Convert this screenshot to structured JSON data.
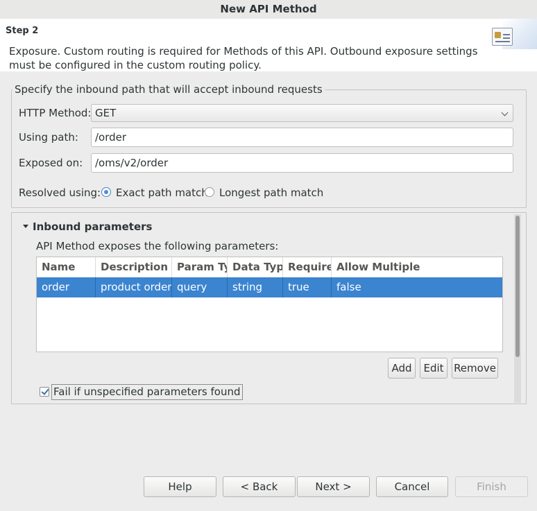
{
  "window": {
    "title": "New API Method"
  },
  "header": {
    "step": "Step 2",
    "description": "Exposure. Custom routing is required for Methods of this API. Outbound exposure settings must be configured in the custom routing policy."
  },
  "inbound_path": {
    "group_title": "Specify the inbound path that will accept inbound requests",
    "http_method_label": "HTTP Method:",
    "http_method_value": "GET",
    "using_path_label": "Using path:",
    "using_path_value": "/order",
    "exposed_on_label": "Exposed on:",
    "exposed_on_value": "/oms/v2/order",
    "resolved_label": "Resolved using:",
    "option_exact": "Exact path match",
    "option_longest": "Longest path match",
    "selected_option": "Exact path match"
  },
  "parameters": {
    "section_title": "Inbound parameters",
    "intro": "API Method exposes the following parameters:",
    "columns": [
      "Name",
      "Description",
      "Param Ty",
      "Data Typ",
      "Require",
      "Allow Multiple"
    ],
    "rows": [
      [
        "order",
        "product order",
        "query",
        "string",
        "true",
        "false"
      ]
    ],
    "add_label": "Add",
    "edit_label": "Edit",
    "remove_label": "Remove",
    "fail_checkbox_label": "Fail if unspecified parameters found",
    "fail_checked": true
  },
  "footer": {
    "help": "Help",
    "back": "< Back",
    "next": "Next >",
    "cancel": "Cancel",
    "finish": "Finish"
  },
  "colors": {
    "selection": "#3b84d0",
    "radio_accent": "#4a90d9"
  },
  "icons": [
    "wizard-banner-icon",
    "chevron-down-icon",
    "expand-triangle-icon",
    "checkmark-icon"
  ]
}
